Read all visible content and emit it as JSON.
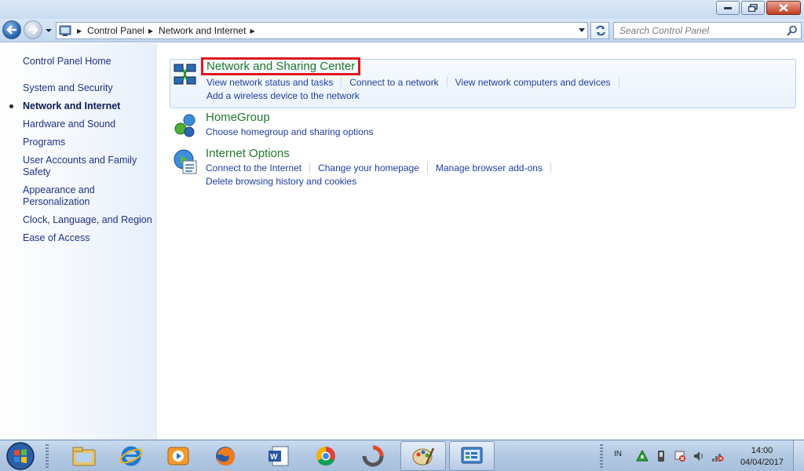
{
  "window": {
    "controls": [
      "minimize",
      "restore",
      "close"
    ]
  },
  "nav": {
    "breadcrumbs": [
      "Control Panel",
      "Network and Internet"
    ],
    "search_placeholder": "Search Control Panel"
  },
  "sidebar": {
    "home": "Control Panel Home",
    "items": [
      {
        "label": "System and Security",
        "current": false
      },
      {
        "label": "Network and Internet",
        "current": true
      },
      {
        "label": "Hardware and Sound",
        "current": false
      },
      {
        "label": "Programs",
        "current": false
      },
      {
        "label": "User Accounts and Family Safety",
        "current": false
      },
      {
        "label": "Appearance and Personalization",
        "current": false
      },
      {
        "label": "Clock, Language, and Region",
        "current": false
      },
      {
        "label": "Ease of Access",
        "current": false
      }
    ]
  },
  "categories": [
    {
      "title": "Network and Sharing Center",
      "icon": "network-icon",
      "links_row1": [
        "View network status and tasks",
        "Connect to a network",
        "View network computers and devices"
      ],
      "links_row2": [
        "Add a wireless device to the network"
      ]
    },
    {
      "title": "HomeGroup",
      "icon": "homegroup-icon",
      "links_row1": [
        "Choose homegroup and sharing options"
      ]
    },
    {
      "title": "Internet Options",
      "icon": "internet-options-icon",
      "links_row1": [
        "Connect to the Internet",
        "Change your homepage",
        "Manage browser add-ons"
      ],
      "links_row2": [
        "Delete browsing history and cookies"
      ]
    }
  ],
  "taskbar": {
    "apps": [
      "explorer-icon",
      "internet-explorer-icon",
      "media-player-icon",
      "firefox-icon",
      "word-icon",
      "chrome-icon",
      "app-icon",
      "paint-icon",
      "control-panel-icon"
    ],
    "language": "IN",
    "time": "14:00",
    "date": "04/04/2017"
  },
  "colors": {
    "highlight_border": "#e0161f",
    "category_title": "#1e7a2c",
    "link": "#1e3ea3"
  }
}
